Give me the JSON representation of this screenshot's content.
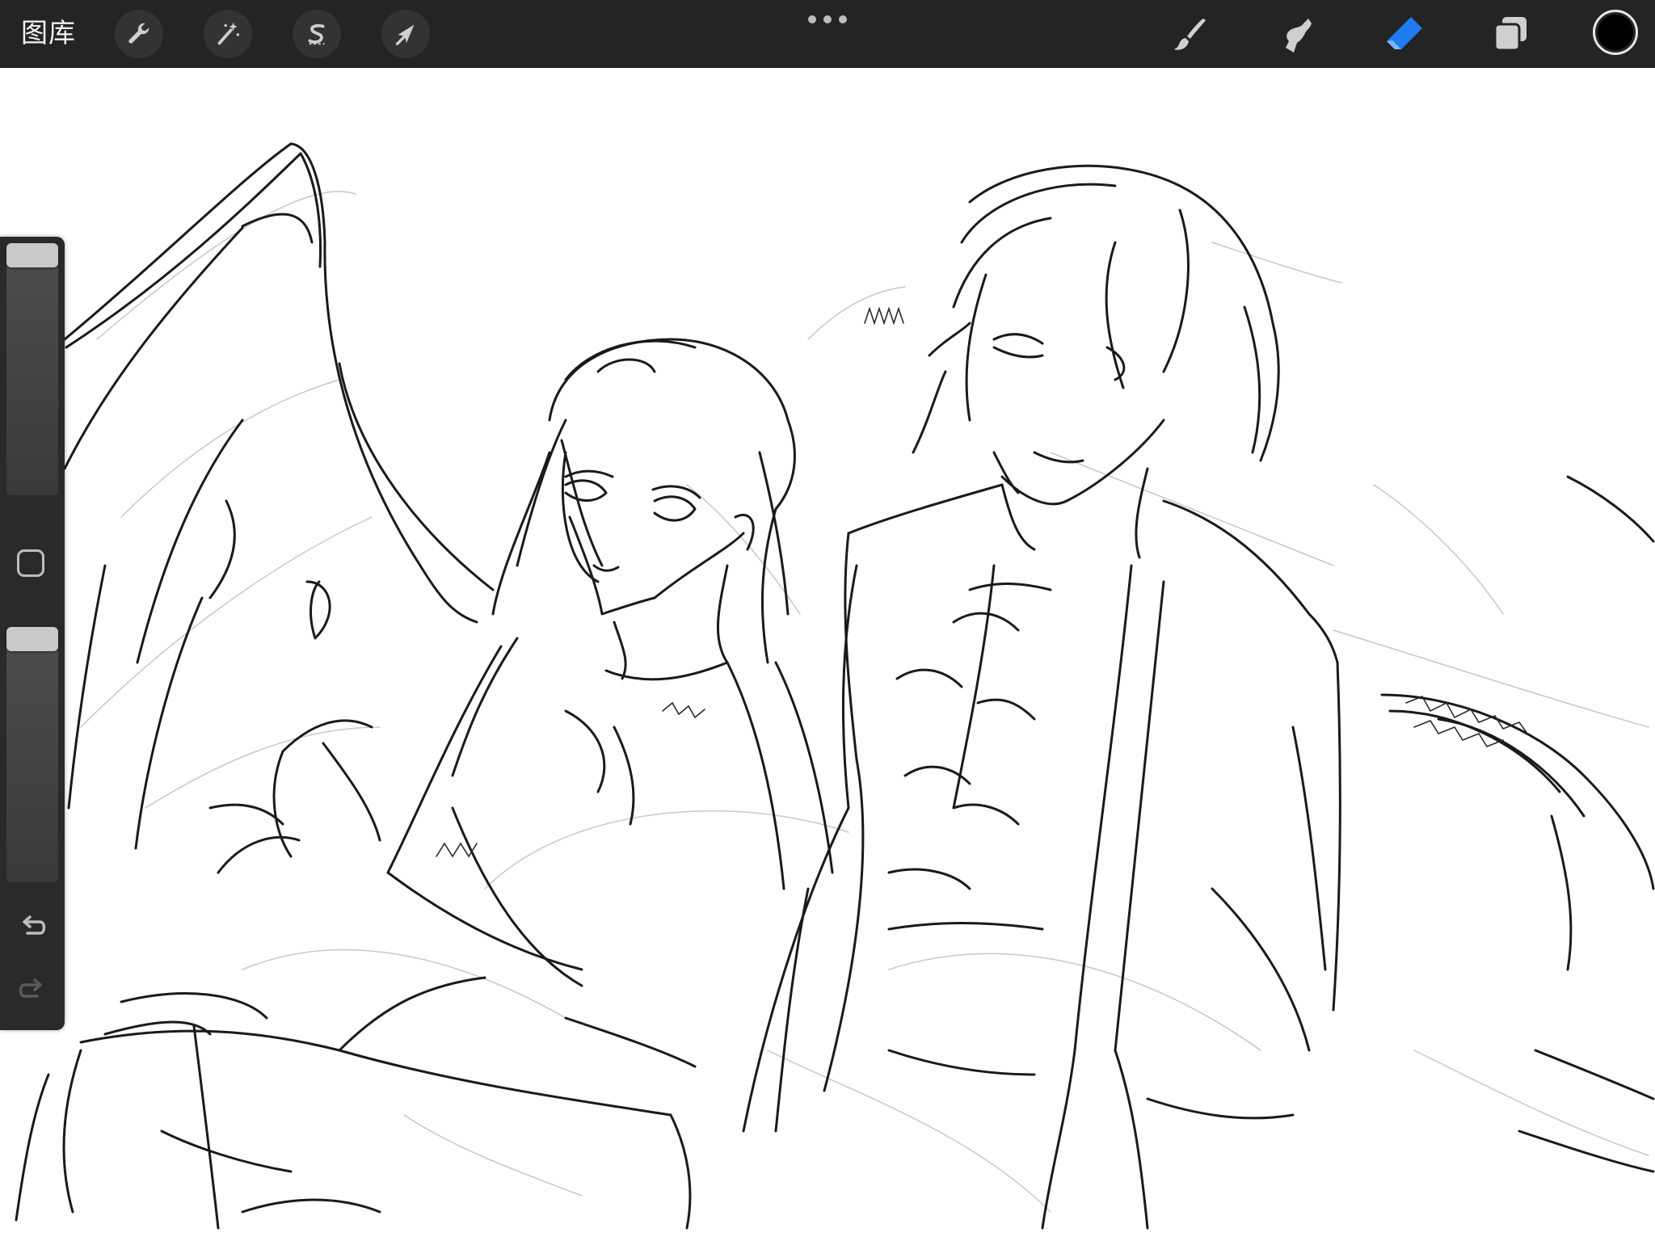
{
  "toolbar": {
    "gallery_label": "图库",
    "actions_icon": "wrench-icon",
    "adjustments_icon": "magic-wand-icon",
    "selection_icon": "selection-s-icon",
    "transform_icon": "arrow-cursor-icon",
    "more_icon": "ellipsis-icon",
    "tools": [
      {
        "name": "brush",
        "icon": "brush-icon",
        "active": false
      },
      {
        "name": "smudge",
        "icon": "smudge-icon",
        "active": false
      },
      {
        "name": "eraser",
        "icon": "eraser-icon",
        "active": true
      },
      {
        "name": "layers",
        "icon": "layers-icon",
        "active": false
      }
    ],
    "current_color": "#000000"
  },
  "sidebar": {
    "brush_size_level": 0.0,
    "brush_opacity_level": 0.0,
    "modify_icon": "square-outline-icon",
    "undo_icon": "undo-icon",
    "redo_icon": "redo-icon",
    "redo_enabled": false
  },
  "canvas": {
    "content": "line-art sketch",
    "background_color": "#ffffff",
    "stroke_color": "#1a1a1a"
  },
  "colors": {
    "toolbar_bg": "#242424",
    "active_tool": "#1e7bf2",
    "icon_default": "#d0d0d0",
    "sidebar_bg": "#2a2a2a"
  }
}
